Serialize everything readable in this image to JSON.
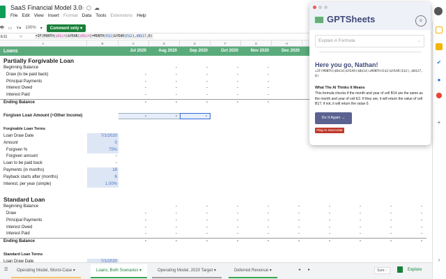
{
  "app": {
    "title": "SaaS Financial Model 3.0",
    "menus": [
      "File",
      "Edit",
      "View",
      "Insert",
      "Format",
      "Data",
      "Tools",
      "Extensions",
      "Help"
    ],
    "dim_menus": [
      "Format",
      "Extensions"
    ],
    "zoom": "100%",
    "comment_only": "Comment only",
    "cell_ref": "E11",
    "fx": "fx"
  },
  "formula": {
    "p1": "=IF(MONTH(",
    "r1": "$B$14",
    "p2": ")&YEAR(",
    "r2": "$B$14",
    "p3": ")=MONTH(",
    "r3": "E$2",
    "p4": ")&YEAR(",
    "r4": "E$2",
    "p5": "),",
    "r5": "$B$17",
    "p6": ",0)"
  },
  "columns": [
    "A",
    "B",
    "C",
    "D",
    "E",
    "F",
    "G",
    "H",
    "I",
    "J",
    "K",
    "L"
  ],
  "header": {
    "label": "Loans",
    "months": [
      "Jul 2020",
      "Aug 2020",
      "Sep 2020",
      "Oct 2020",
      "Nov 2020",
      "Dec 2020"
    ]
  },
  "rows": [
    {
      "type": "sec",
      "label": "Partially Forgivable Loan"
    },
    {
      "label": "Beginning Balance",
      "dash_from": 3,
      "dash_to": 6
    },
    {
      "label": "Draw (to be paid back)",
      "ind": true,
      "dash_from": 2,
      "dash_to": 6
    },
    {
      "label": "Principal Payments",
      "ind": true,
      "dash_from": 2,
      "dash_to": 6
    },
    {
      "label": "Interest Owed",
      "ind": true,
      "dash_from": 2,
      "dash_to": 6
    },
    {
      "label": "Interest Paid",
      "ind": true,
      "dash_from": 2,
      "dash_to": 6
    },
    {
      "type": "bold line",
      "label": "Ending Balance",
      "dash_from": 2,
      "dash_to": 6
    },
    {
      "type": "blank"
    },
    {
      "type": "bold",
      "label": "Forgiven Loan Amount (=Other Income)",
      "dash_from": 2,
      "dash_to": 4,
      "selected": true
    },
    {
      "type": "blank"
    },
    {
      "type": "sub",
      "label": "Forgivable Loan Terms"
    },
    {
      "label": "Loan Draw Date",
      "b": "7/1/2020",
      "input": true
    },
    {
      "label": "Amount",
      "b": "0",
      "input": true
    },
    {
      "label": "Forgiven %",
      "ind": true,
      "b": "75%",
      "input": true
    },
    {
      "label": "Forgiven amount",
      "ind": true,
      "b": "-"
    },
    {
      "label": "Loan to be paid back",
      "b": "-"
    },
    {
      "label": "Payments (in months)",
      "b": "18",
      "input": true
    },
    {
      "label": "Payback starts after (months)",
      "b": "6",
      "input": true
    },
    {
      "label": "Interest, per year (simple)",
      "b": "1.00%",
      "input": true
    },
    {
      "type": "blank"
    },
    {
      "type": "sec",
      "label": "Standard Loan"
    },
    {
      "label": "Beginning Balance",
      "dash_from": 3,
      "dash_to": 11
    },
    {
      "label": "Draw",
      "ind": true,
      "dash_from": 2,
      "dash_to": 11
    },
    {
      "label": "Principal Payments",
      "ind": true,
      "dash_from": 2,
      "dash_to": 11
    },
    {
      "label": "Interest Owed",
      "ind": true,
      "dash_from": 2,
      "dash_to": 11
    },
    {
      "label": "Interest Paid",
      "ind": true,
      "dash_from": 2,
      "dash_to": 11
    },
    {
      "type": "bold line",
      "label": "Ending Balance",
      "dash_from": 2,
      "dash_to": 11
    },
    {
      "type": "blank"
    },
    {
      "type": "sub",
      "label": "Standard Loan Terms"
    },
    {
      "label": "Loan Draw Date",
      "b": "7/1/2020",
      "input": true
    }
  ],
  "tabs": [
    "Operating Model, Worst-Case",
    "Loans, Both Scenarios",
    "Operating Model, 2020 Target",
    "Deferred Revenue"
  ],
  "active_tab": 1,
  "sum": "Sum: -",
  "explore": "Explore",
  "panel": {
    "title": "GPTSheets",
    "select": "Explain A Formula",
    "greeting": "Here you go, Nathan!",
    "formula": "=IF(MONTH($B$14)&YEAR($B$14)=MONTH(E$2)&YEAR(E$2),$B$17,0)",
    "meaning_title": "What The AI Thinks It Means",
    "meaning": "This formula checks if the month and year of cell B14 are the same as the month and year of cell E2. If they are, it will return the value of cell B17; if not, it will return the value 0.",
    "again": "Do It Again →",
    "flag": "Flag As Inaccurate"
  },
  "colors": {
    "header_green": "#5aab7c",
    "accent": "#5a6290",
    "flag": "#c0392b"
  }
}
